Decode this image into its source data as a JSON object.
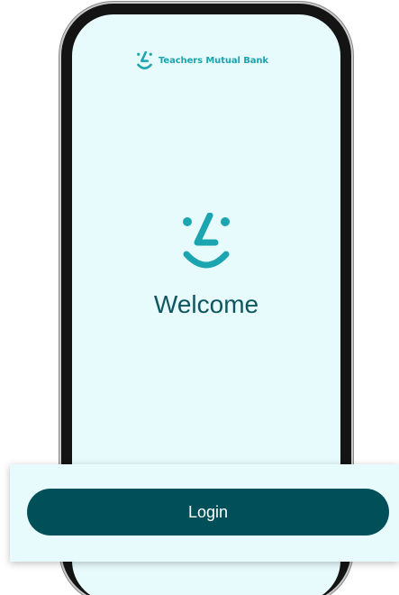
{
  "brand": {
    "name": "Teachers Mutual Bank",
    "logo_icon": "smile-logo-icon",
    "color": "#1aa5b0"
  },
  "welcome": {
    "title": "Welcome",
    "logo_icon": "smile-logo-icon",
    "title_color": "#0f5660"
  },
  "login": {
    "label": "Login",
    "button_color": "#015059"
  },
  "theme": {
    "screen_background": "#e8fbfc"
  }
}
